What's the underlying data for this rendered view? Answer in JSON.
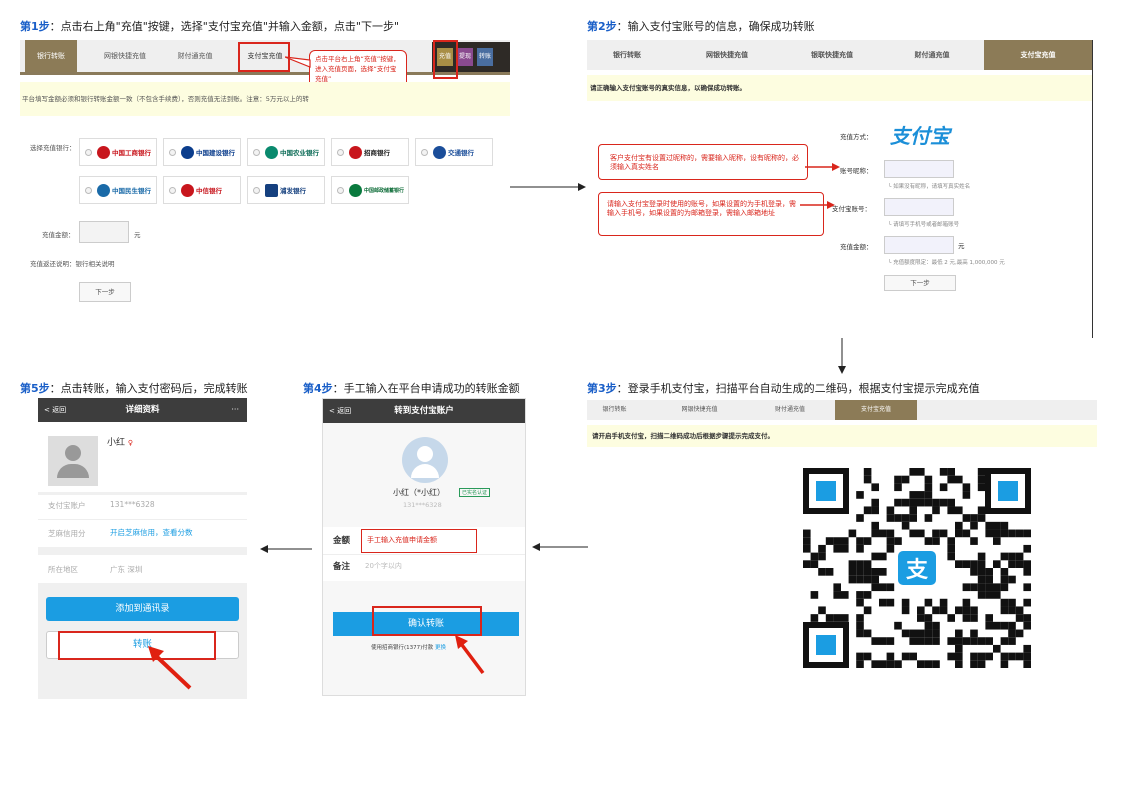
{
  "steps": {
    "s1": {
      "num": "第1步",
      "text": "：点击右上角\"充值\"按键，选择\"支付宝充值\"并输入金额，点击\"下一步\""
    },
    "s2": {
      "num": "第2步",
      "text": "：输入支付宝账号的信息，确保成功转账"
    },
    "s3": {
      "num": "第3步",
      "text": "：登录手机支付宝，扫描平台自动生成的二维码，根据支付宝提示完成充值"
    },
    "s4": {
      "num": "第4步",
      "text": "：手工输入在平台申请成功的转账金额"
    },
    "s5": {
      "num": "第5步",
      "text": "：点击转账，输入支付密码后，完成转账"
    }
  },
  "panel1": {
    "tabs": [
      "银行转账",
      "网银快捷充值",
      "财付通充值",
      "支付宝充值"
    ],
    "top_buttons": [
      "充值",
      "提现",
      "转账"
    ],
    "callout": "点击平台右上角“充值”按键，进入充值页面，选择“支付宝充值”",
    "notice": "平台填写金额必须和银行转账金额一致（不包含手续费），否则充值无法到账。注意：5万元以上的转",
    "select_bank_label": "选择充值银行：",
    "banks": [
      "中国工商银行",
      "中国建设银行",
      "中国农业银行",
      "招商银行",
      "交通银行",
      "中国民生银行",
      "中信银行",
      "浦发银行",
      "中国邮政储蓄银行"
    ],
    "amount_label": "充值金额：",
    "unit": "元",
    "desc_label": "充值返还说明：",
    "desc_value": "银行相关说明",
    "next": "下一步"
  },
  "panel2": {
    "tabs": [
      "银行转账",
      "网银快捷充值",
      "银联快捷充值",
      "财付通充值",
      "支付宝充值"
    ],
    "notice": "请正确输入支付宝账号的真实信息，以确保成功转账。",
    "method_label": "充值方式：",
    "alipay_logo": "支付宝",
    "nickname_label": "账号昵称：",
    "nickname_hint": "如果没有昵称，请填写真实姓名",
    "account_label": "支付宝账号：",
    "account_hint": "请填写手机号或者邮箱账号",
    "amount_label": "充值金额：",
    "unit": "元",
    "amount_hint": "充值额度限定：最低 2 元,最高 1,000,000 元",
    "next": "下一步",
    "note1": "客户支付宝有设置过昵称的，需要输入昵称，设有昵称的，必须输入真实姓名",
    "note2": "请输入支付宝登录时使用的账号，如果设置的为手机登录，需输入手机号，如果设置的为邮箱登录，需输入邮箱地址"
  },
  "panel3": {
    "tabs": [
      "银行转账",
      "网银快捷充值",
      "财付通充值",
      "支付宝充值"
    ],
    "notice": "请开启手机支付宝，扫描二维码成功后根据步骤提示完成支付。"
  },
  "phone4": {
    "back": "返回",
    "title": "转到支付宝账户",
    "name": "小红（*小红）",
    "badge": "已实名认证",
    "account": "131***6328",
    "amount_label": "金额",
    "amount_callout": "手工输入充值申请金额",
    "note_label": "备注",
    "note_placeholder": "20个字以内",
    "confirm": "确认转账",
    "footer": "使用招商银行(1377)付款",
    "change": "更换"
  },
  "phone5": {
    "back": "返回",
    "title": "详细资料",
    "more": "···",
    "name": "小红",
    "acct_label": "支付宝账户",
    "acct_value": "131***6328",
    "credit_label": "芝麻信用分",
    "credit_value": "开启芝麻信用，查看分数",
    "region_label": "所在地区",
    "region_value": "广东 深圳",
    "add_contact": "添加到通讯录",
    "transfer": "转账"
  },
  "colors": {
    "step_blue": "#1a5fc8",
    "tab_brown": "#8c7b57",
    "notice_bg": "#fdfde0",
    "alert_red": "#d9261c",
    "alipay_blue": "#1b9de2"
  }
}
